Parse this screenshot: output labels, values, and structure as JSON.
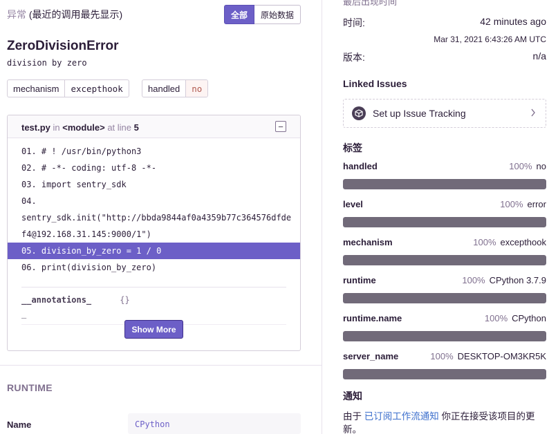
{
  "exception": {
    "section_label": "异常",
    "section_sub": "(最近的调用最先显示)",
    "toggle_all": "全部",
    "toggle_raw": "原始数据",
    "type": "ZeroDivisionError",
    "message": "division by zero",
    "mechanism_key": "mechanism",
    "mechanism_value": "excepthook",
    "handled_key": "handled",
    "handled_value": "no"
  },
  "frame": {
    "file": "test.py",
    "in_label": "in",
    "function": "<module>",
    "at_line_label": "at line",
    "line_no": "5",
    "collapse_symbol": "−",
    "lines": [
      "01. # ! /usr/bin/python3",
      "02. # -*- coding: utf-8 -*-",
      "03. import sentry_sdk",
      "04.",
      "sentry_sdk.init(\"http://bbda9844af0a4359b77c364576dfde",
      "f4@192.168.31.145:9000/1\")",
      "05. division_by_zero = 1 / 0",
      "06. print(division_by_zero)"
    ],
    "active_line_index": 6,
    "var_key": "__annotations_",
    "var_value": "{}",
    "var_continued": "_",
    "show_more": "Show More"
  },
  "runtime": {
    "heading": "RUNTIME",
    "name_key": "Name",
    "name_value": "CPython"
  },
  "sidebar": {
    "truncated_label": "最后出现时间",
    "time_label": "时间:",
    "time_value": "42 minutes ago",
    "time_date": "Mar 31, 2021 6:43:26 AM UTC",
    "version_label": "版本:",
    "version_value": "n/a",
    "linked_issues_heading": "Linked Issues",
    "tracking_label": "Set up Issue Tracking",
    "tags_heading": "标签",
    "tags": [
      {
        "key": "handled",
        "pct": "100%",
        "value": "no",
        "fill": 1.0
      },
      {
        "key": "level",
        "pct": "100%",
        "value": "error",
        "fill": 1.0
      },
      {
        "key": "mechanism",
        "pct": "100%",
        "value": "excepthook",
        "fill": 1.0
      },
      {
        "key": "runtime",
        "pct": "100%",
        "value": "CPython 3.7.9",
        "fill": 1.0
      },
      {
        "key": "runtime.name",
        "pct": "100%",
        "value": "CPython",
        "fill": 1.0
      },
      {
        "key": "server_name",
        "pct": "100%",
        "value": "DESKTOP-OM3KR5K",
        "fill": 1.0
      }
    ],
    "notify_heading": "通知",
    "notify_prefix": "由于 ",
    "notify_link": "已订阅工作流通知",
    "notify_suffix": " 你正在接受该项目的更新。"
  },
  "colors": {
    "accent": "#6c5fc7",
    "tag_bar": "#716a79",
    "link": "#3b6ecc"
  }
}
